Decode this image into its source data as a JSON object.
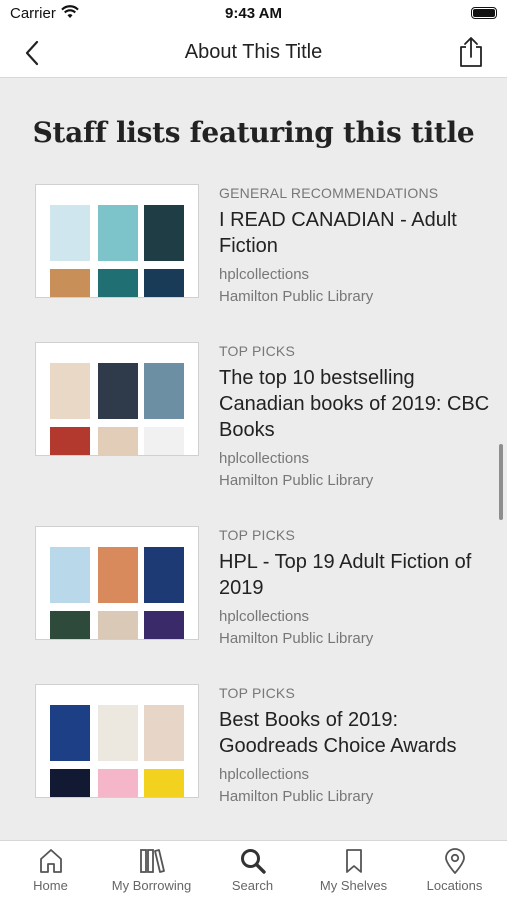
{
  "status": {
    "carrier": "Carrier",
    "time": "9:43 AM"
  },
  "nav": {
    "title": "About This Title"
  },
  "heading": "Staff lists featuring this title",
  "lists": [
    {
      "category": "GENERAL RECOMMENDATIONS",
      "title": "I READ CANADIAN - Adult Fiction",
      "user": "hplcollections",
      "library": "Hamilton Public Library"
    },
    {
      "category": "TOP PICKS",
      "title": "The top 10 bestselling Canadian books of 2019: CBC Books",
      "user": "hplcollections",
      "library": "Hamilton Public Library"
    },
    {
      "category": "TOP PICKS",
      "title": "HPL - Top 19 Adult Fiction of 2019",
      "user": "hplcollections",
      "library": "Hamilton Public Library"
    },
    {
      "category": "TOP PICKS",
      "title": "Best Books of 2019: Goodreads Choice Awards",
      "user": "hplcollections",
      "library": "Hamilton Public Library"
    }
  ],
  "tabs": [
    {
      "label": "Home",
      "icon": "home-icon"
    },
    {
      "label": "My Borrowing",
      "icon": "books-icon"
    },
    {
      "label": "Search",
      "icon": "search-icon"
    },
    {
      "label": "My Shelves",
      "icon": "bookmark-icon"
    },
    {
      "label": "Locations",
      "icon": "location-pin-icon"
    }
  ],
  "colors": {
    "background": "#ececec",
    "active_tab": "#222222",
    "inactive_tab": "#666666"
  }
}
